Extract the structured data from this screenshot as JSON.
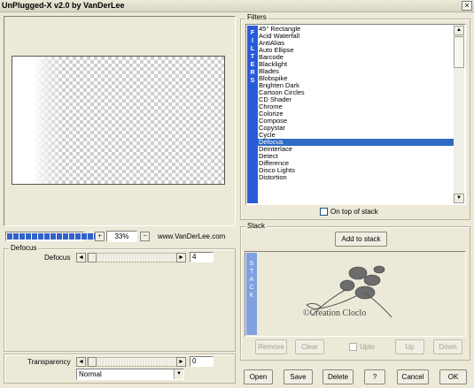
{
  "window": {
    "title": "UnPlugged-X v2.0 by VanDerLee",
    "close_glyph": "×"
  },
  "preview": {
    "progress_segments": 15,
    "zoom_value": "33%",
    "website": "www.VanDerLee.com"
  },
  "filters": {
    "group_label": "Filters",
    "side_banner": "F I L T E R S",
    "items": [
      "45° Rectangle",
      "Acid Waterfall",
      "AntiAlias",
      "Auto Ellipse",
      "Barcode",
      "Blacklight",
      "Blades",
      "Blobspike",
      "Brighten Dark",
      "Cartoon Circles",
      "CD Shader",
      "Chrome",
      "Colorize",
      "Compose",
      "Copystar",
      "Cycle",
      "Defocus",
      "Deinterlace",
      "Detect",
      "Difference",
      "Disco Lights",
      "Distortion"
    ],
    "selected": "Defocus",
    "on_top_label": "On top of stack",
    "on_top_checked": false
  },
  "stack": {
    "group_label": "Stack",
    "add_button": "Add to stack",
    "side_banner": "S T A C K",
    "watermark_text": "©Creation Cloclo",
    "remove_button": "Remove",
    "clear_button": "Clear",
    "upto_label": "Upto",
    "up_button": "Up",
    "down_button": "Down"
  },
  "defocus": {
    "group_label": "Defocus",
    "param_label": "Defocus",
    "value": "4",
    "slider_fraction": 0.0
  },
  "transparency": {
    "label": "Transparency",
    "value": "0",
    "blend_mode": "Normal"
  },
  "footer": {
    "open": "Open",
    "save": "Save",
    "delete": "Delete",
    "help": "?",
    "cancel": "Cancel",
    "ok": "OK"
  },
  "colors": {
    "accent": "#2a5bd7",
    "selection": "#316ac5",
    "window_bg": "#ece9d8"
  }
}
